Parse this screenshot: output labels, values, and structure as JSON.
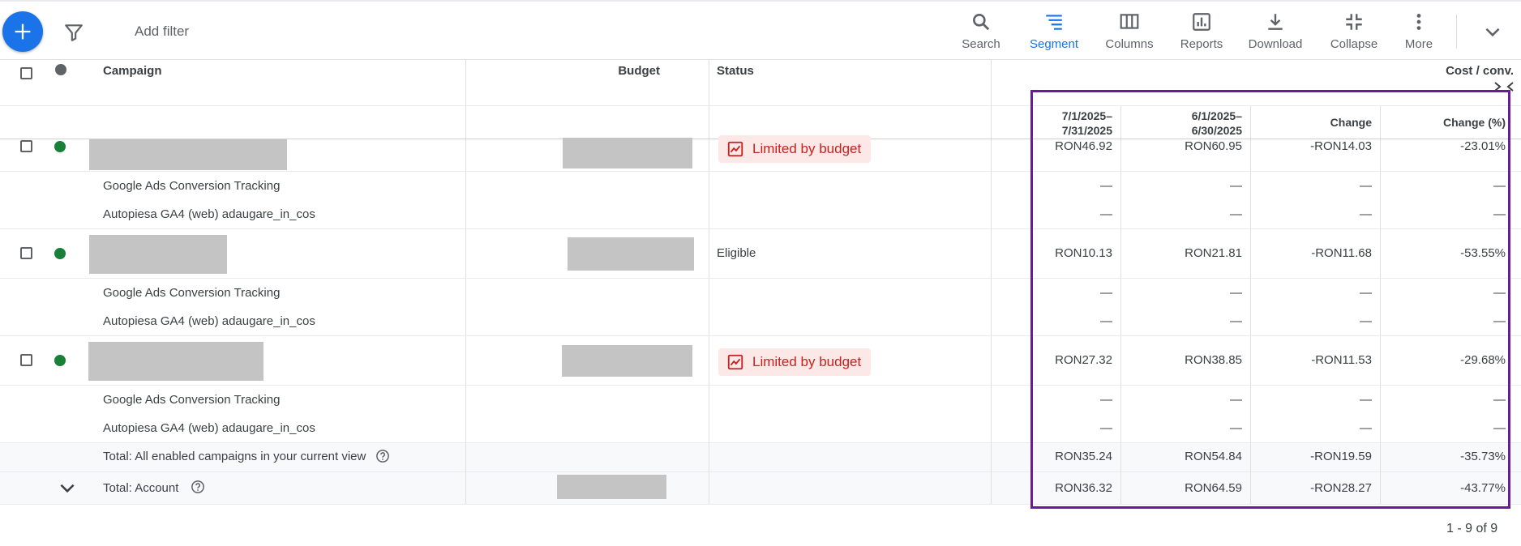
{
  "toolbar": {
    "add_filter": "Add filter",
    "tools": [
      {
        "label": "Search",
        "icon": "search-icon"
      },
      {
        "label": "Segment",
        "icon": "segment-icon",
        "active": true
      },
      {
        "label": "Columns",
        "icon": "columns-icon"
      },
      {
        "label": "Reports",
        "icon": "reports-icon"
      },
      {
        "label": "Download",
        "icon": "download-icon"
      },
      {
        "label": "Collapse",
        "icon": "collapse-icon"
      },
      {
        "label": "More",
        "icon": "more-vert-icon"
      }
    ],
    "accent_color": "#1a73e8"
  },
  "table": {
    "headers": {
      "campaign": "Campaign",
      "budget": "Budget",
      "status": "Status",
      "metric": "Cost / conv."
    },
    "subheaders": {
      "period1": "7/1/2025–\n7/31/2025",
      "period2": "6/1/2025–\n6/30/2025",
      "change": "Change",
      "change_pct": "Change (%)"
    },
    "campaigns": [
      {
        "status": "Limited by budget",
        "status_type": "limited",
        "p1": "RON46.92",
        "p2": "RON60.95",
        "change": "-RON14.03",
        "pct": "-23.01%"
      },
      {
        "status": "Eligible",
        "status_type": "eligible",
        "p1": "RON10.13",
        "p2": "RON21.81",
        "change": "-RON11.68",
        "pct": "-53.55%"
      },
      {
        "status": "Limited by budget",
        "status_type": "limited",
        "p1": "RON27.32",
        "p2": "RON38.85",
        "change": "-RON11.53",
        "pct": "-29.68%"
      }
    ],
    "conversion_rows": {
      "row1": "Google Ads Conversion Tracking",
      "row2": "Autopiesa GA4 (web) adaugare_in_cos",
      "empty": "—"
    },
    "totals": [
      {
        "label": "Total: All enabled campaigns in your current view",
        "p1": "RON35.24",
        "p2": "RON54.84",
        "change": "-RON19.59",
        "pct": "-35.73%"
      },
      {
        "label": "Total: Account",
        "p1": "RON36.32",
        "p2": "RON64.59",
        "change": "-RON28.27",
        "pct": "-43.77%"
      }
    ],
    "status_dot_enabled_color": "#188038",
    "limited_color": "#c5221f",
    "highlight_color": "#6a1b9a"
  },
  "pager": "1 - 9 of 9"
}
